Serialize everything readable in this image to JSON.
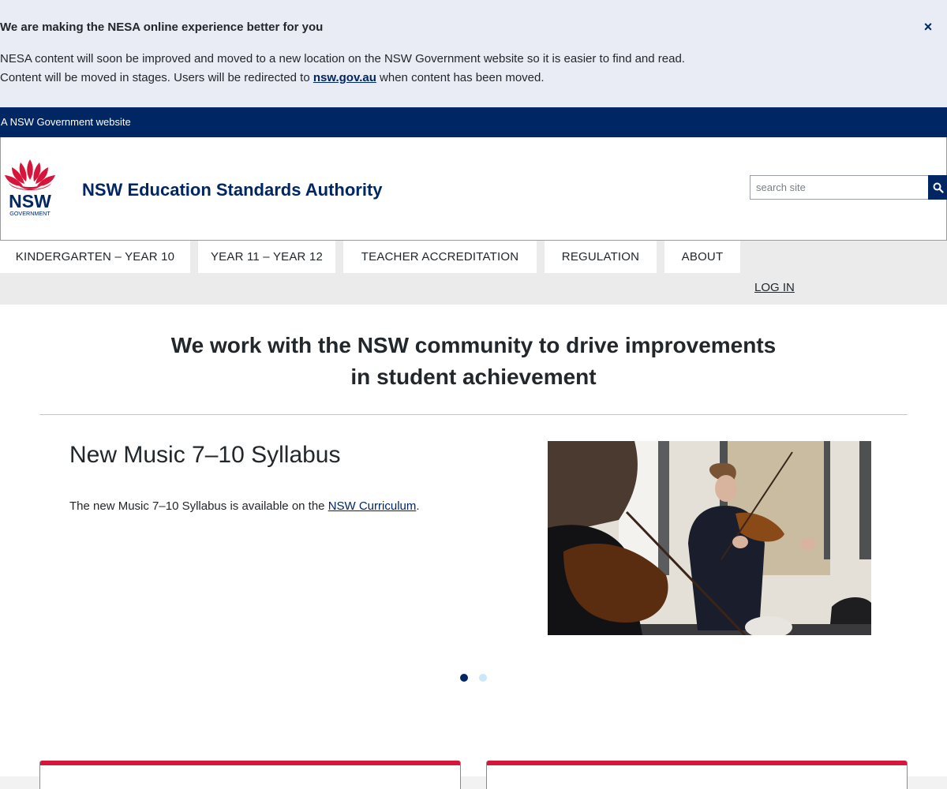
{
  "notice": {
    "title": "We are making the NESA online experience better for you",
    "line1": "NESA content will soon be improved and moved to a new location on the NSW Government website so it is easier to find and read.",
    "line2_before": "Content will be moved in stages. Users will be redirected to ",
    "line2_link": "nsw.gov.au",
    "line2_after": " when content has been moved.",
    "close_glyph": "×"
  },
  "govbar": {
    "text": "A NSW Government website"
  },
  "header": {
    "logo_text": "NSW",
    "logo_subtext": "GOVERNMENT",
    "site_title": "NSW Education Standards Authority",
    "search_placeholder": "search site",
    "search_value": ""
  },
  "nav": {
    "items": [
      {
        "label": "KINDERGARTEN – YEAR 10"
      },
      {
        "label": "YEAR 11 – YEAR 12"
      },
      {
        "label": "TEACHER ACCREDITATION"
      },
      {
        "label": "REGULATION"
      },
      {
        "label": "ABOUT"
      }
    ],
    "login": "LOG IN"
  },
  "hero": {
    "line1": "We work with the NSW community to drive improvements",
    "line2": "in student achievement"
  },
  "carousel": {
    "slide": {
      "title": "New Music 7–10 Syllabus",
      "text_before": "The new Music 7–10 Syllabus is available on the ",
      "link": "NSW Curriculum",
      "text_after": ".",
      "image_alt": "Students playing violins"
    },
    "total_slides": 2,
    "active_slide": 1
  },
  "colors": {
    "brand_navy": "#002664",
    "brand_red": "#d7153a",
    "notice_bg": "#e9ecf4",
    "nav_band": "#ebebeb",
    "dot_inactive": "#cbe8f6"
  }
}
